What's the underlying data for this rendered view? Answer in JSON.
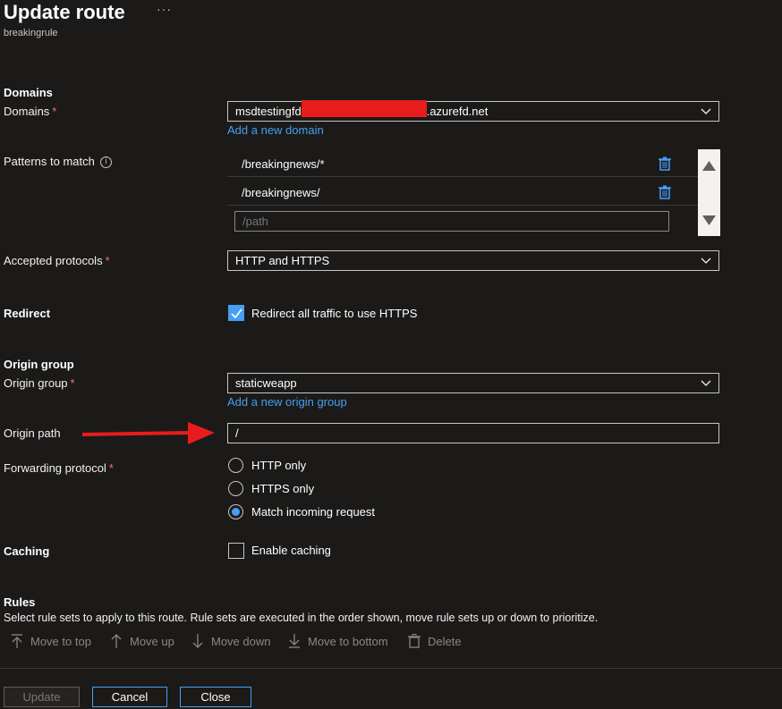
{
  "header": {
    "title": "Update route",
    "subtitle": "breakingrule",
    "more": "···"
  },
  "domains": {
    "section_title": "Domains",
    "label": "Domains",
    "value_prefix": "msdtestingfd",
    "value_suffix": ".azurefd.net",
    "add_link": "Add a new domain"
  },
  "patterns": {
    "label": "Patterns to match",
    "items": [
      "/breakingnews/*",
      "/breakingnews/"
    ],
    "placeholder": "/path"
  },
  "protocols": {
    "label": "Accepted protocols",
    "value": "HTTP and HTTPS"
  },
  "redirect": {
    "label": "Redirect",
    "checkbox_label": "Redirect all traffic to use HTTPS",
    "checked": true
  },
  "origin": {
    "section_title": "Origin group",
    "group_label": "Origin group",
    "group_value": "staticweapp",
    "add_link": "Add a new origin group",
    "path_label": "Origin path",
    "path_value": "/"
  },
  "forwarding": {
    "label": "Forwarding protocol",
    "options": [
      "HTTP only",
      "HTTPS only",
      "Match incoming request"
    ],
    "selected": "Match incoming request"
  },
  "caching": {
    "label": "Caching",
    "checkbox_label": "Enable caching",
    "checked": false
  },
  "rules": {
    "section_title": "Rules",
    "description": "Select rule sets to apply to this route. Rule sets are executed in the order shown, move rule sets up or down to prioritize.",
    "toolbar": {
      "move_top": "Move to top",
      "move_up": "Move up",
      "move_down": "Move down",
      "move_bottom": "Move to bottom",
      "delete": "Delete"
    }
  },
  "footer": {
    "update": "Update",
    "cancel": "Cancel",
    "close": "Close"
  },
  "colors": {
    "accent": "#479ef5",
    "required": "#f1707b",
    "annotation_arrow": "#e81c1c",
    "background": "#1b1a19"
  }
}
